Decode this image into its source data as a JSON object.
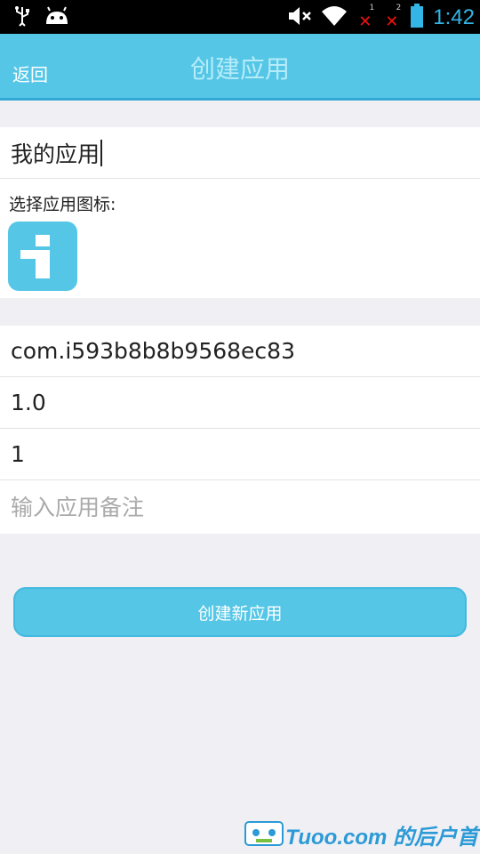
{
  "status_bar": {
    "time": "1:42",
    "sim1_number": "1",
    "sim2_number": "2"
  },
  "header": {
    "back_label": "返回",
    "title": "创建应用"
  },
  "form": {
    "app_name_value": "我的应用",
    "icon_label": "选择应用图标:",
    "package_value": "com.i593b8b8b9568ec83",
    "version_name_value": "1.0",
    "version_code_value": "1",
    "remark_placeholder": "输入应用备注"
  },
  "actions": {
    "create_label": "创建新应用"
  },
  "watermark": {
    "text": "Tuoo.com 的后户首"
  },
  "colors": {
    "accent": "#55c6e6",
    "background": "#efeff4",
    "time_blue": "#33b5e5"
  }
}
